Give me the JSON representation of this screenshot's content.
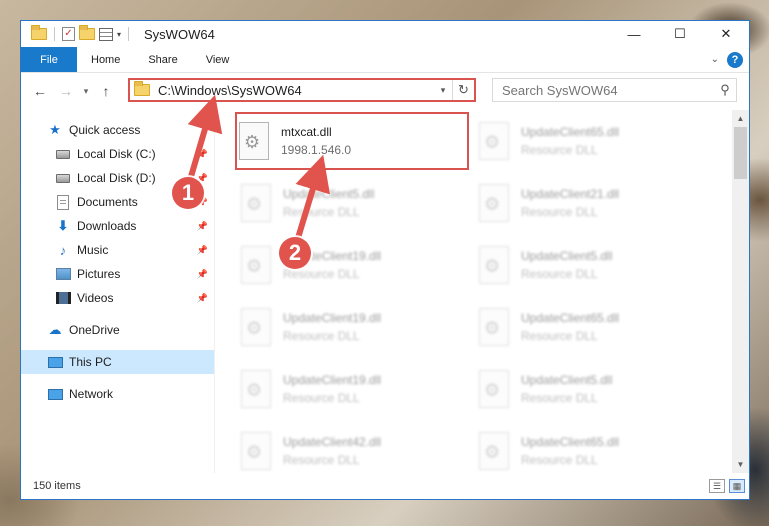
{
  "window": {
    "title": "SysWOW64",
    "controls": {
      "minimize": "—",
      "maximize": "☐",
      "close": "✕"
    }
  },
  "ribbon": {
    "tabs": [
      "File",
      "Home",
      "Share",
      "View"
    ],
    "help": "?"
  },
  "navbar": {
    "address": "C:\\Windows\\SysWOW64",
    "search_placeholder": "Search SysWOW64"
  },
  "sidebar": {
    "items": [
      {
        "label": "Quick access",
        "icon": "star-icon"
      },
      {
        "label": "Local Disk (C:)",
        "icon": "drive-icon",
        "pinned": true
      },
      {
        "label": "Local Disk (D:)",
        "icon": "drive-icon",
        "pinned": true
      },
      {
        "label": "Documents",
        "icon": "document-icon",
        "pinned": true
      },
      {
        "label": "Downloads",
        "icon": "download-icon",
        "pinned": true
      },
      {
        "label": "Music",
        "icon": "music-icon",
        "pinned": true
      },
      {
        "label": "Pictures",
        "icon": "pictures-icon",
        "pinned": true
      },
      {
        "label": "Videos",
        "icon": "videos-icon",
        "pinned": true
      },
      {
        "label": "OneDrive",
        "icon": "cloud-icon"
      },
      {
        "label": "This PC",
        "icon": "computer-icon",
        "selected": true
      },
      {
        "label": "Network",
        "icon": "network-icon"
      }
    ]
  },
  "files": [
    {
      "name": "mtxcat.dll",
      "desc": "1998.1.546.0"
    },
    {
      "name": "UpdateClient65.dll",
      "desc": "Resource DLL"
    },
    {
      "name": "UpdateClient5.dll",
      "desc": "Resource DLL"
    },
    {
      "name": "UpdateClient21.dll",
      "desc": "Resource DLL"
    },
    {
      "name": "UpdateClient19.dll",
      "desc": "Resource DLL"
    },
    {
      "name": "UpdateClient5.dll",
      "desc": "Resource DLL"
    },
    {
      "name": "UpdateClient19.dll",
      "desc": "Resource DLL"
    },
    {
      "name": "UpdateClient65.dll",
      "desc": "Resource DLL"
    },
    {
      "name": "UpdateClient19.dll",
      "desc": "Resource DLL"
    },
    {
      "name": "UpdateClient5.dll",
      "desc": "Resource DLL"
    },
    {
      "name": "UpdateClient42.dll",
      "desc": "Resource DLL"
    },
    {
      "name": "UpdateClient65.dll",
      "desc": "Resource DLL"
    }
  ],
  "status": {
    "item_count": "150 items"
  },
  "annotations": {
    "step1": "1",
    "step2": "2",
    "color": "#e0544d"
  }
}
